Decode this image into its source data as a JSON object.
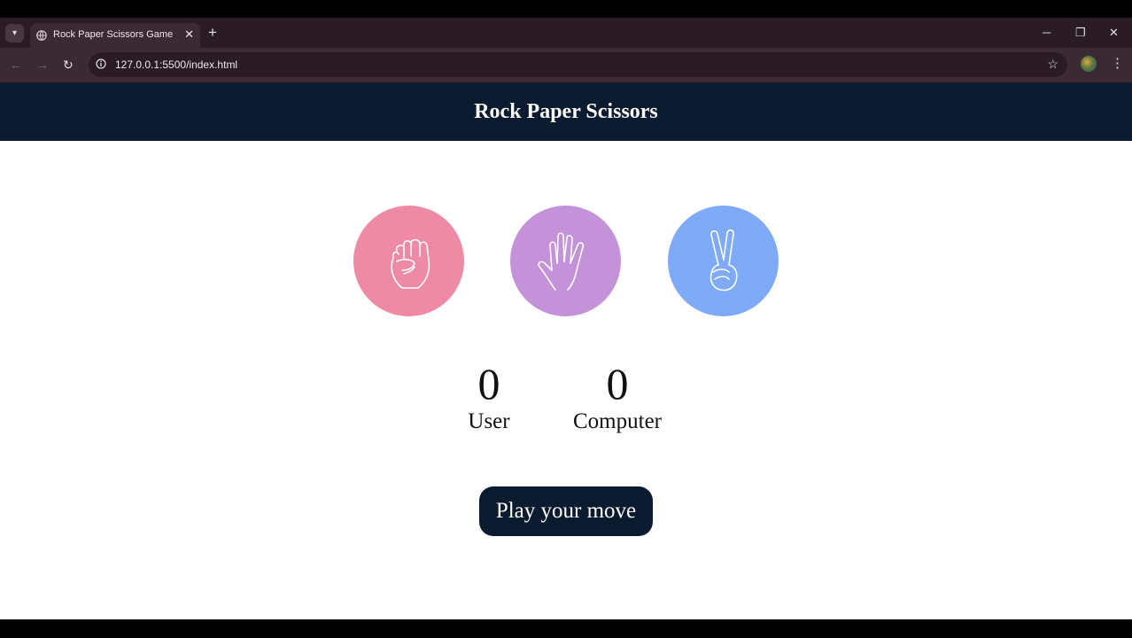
{
  "browser": {
    "tab_title": "Rock Paper Scissors Game",
    "url": "127.0.0.1:5500/index.html",
    "icons": {
      "tab_search": "chevron-down-icon",
      "tab_close": "close-icon",
      "new_tab": "plus-icon",
      "back": "back-arrow-icon",
      "forward": "forward-arrow-icon",
      "reload": "reload-icon",
      "site_info": "info-icon",
      "bookmark": "star-icon",
      "profile": "profile-avatar",
      "menu": "kebab-menu-icon",
      "minimize": "minimize-icon",
      "restore": "restore-icon",
      "close_window": "close-icon"
    }
  },
  "app": {
    "title": "Rock Paper Scissors",
    "choices": [
      {
        "id": "rock",
        "icon": "fist-icon",
        "color": "#ee8aa5"
      },
      {
        "id": "paper",
        "icon": "open-hand-icon",
        "color": "#c392d8"
      },
      {
        "id": "scissors",
        "icon": "peace-sign-icon",
        "color": "#7eaaf7"
      }
    ],
    "scores": {
      "user": {
        "value": "0",
        "label": "User"
      },
      "computer": {
        "value": "0",
        "label": "Computer"
      }
    },
    "message": "Play your move",
    "colors": {
      "header": "#0a1a2f",
      "button": "#0a1a2f"
    }
  }
}
